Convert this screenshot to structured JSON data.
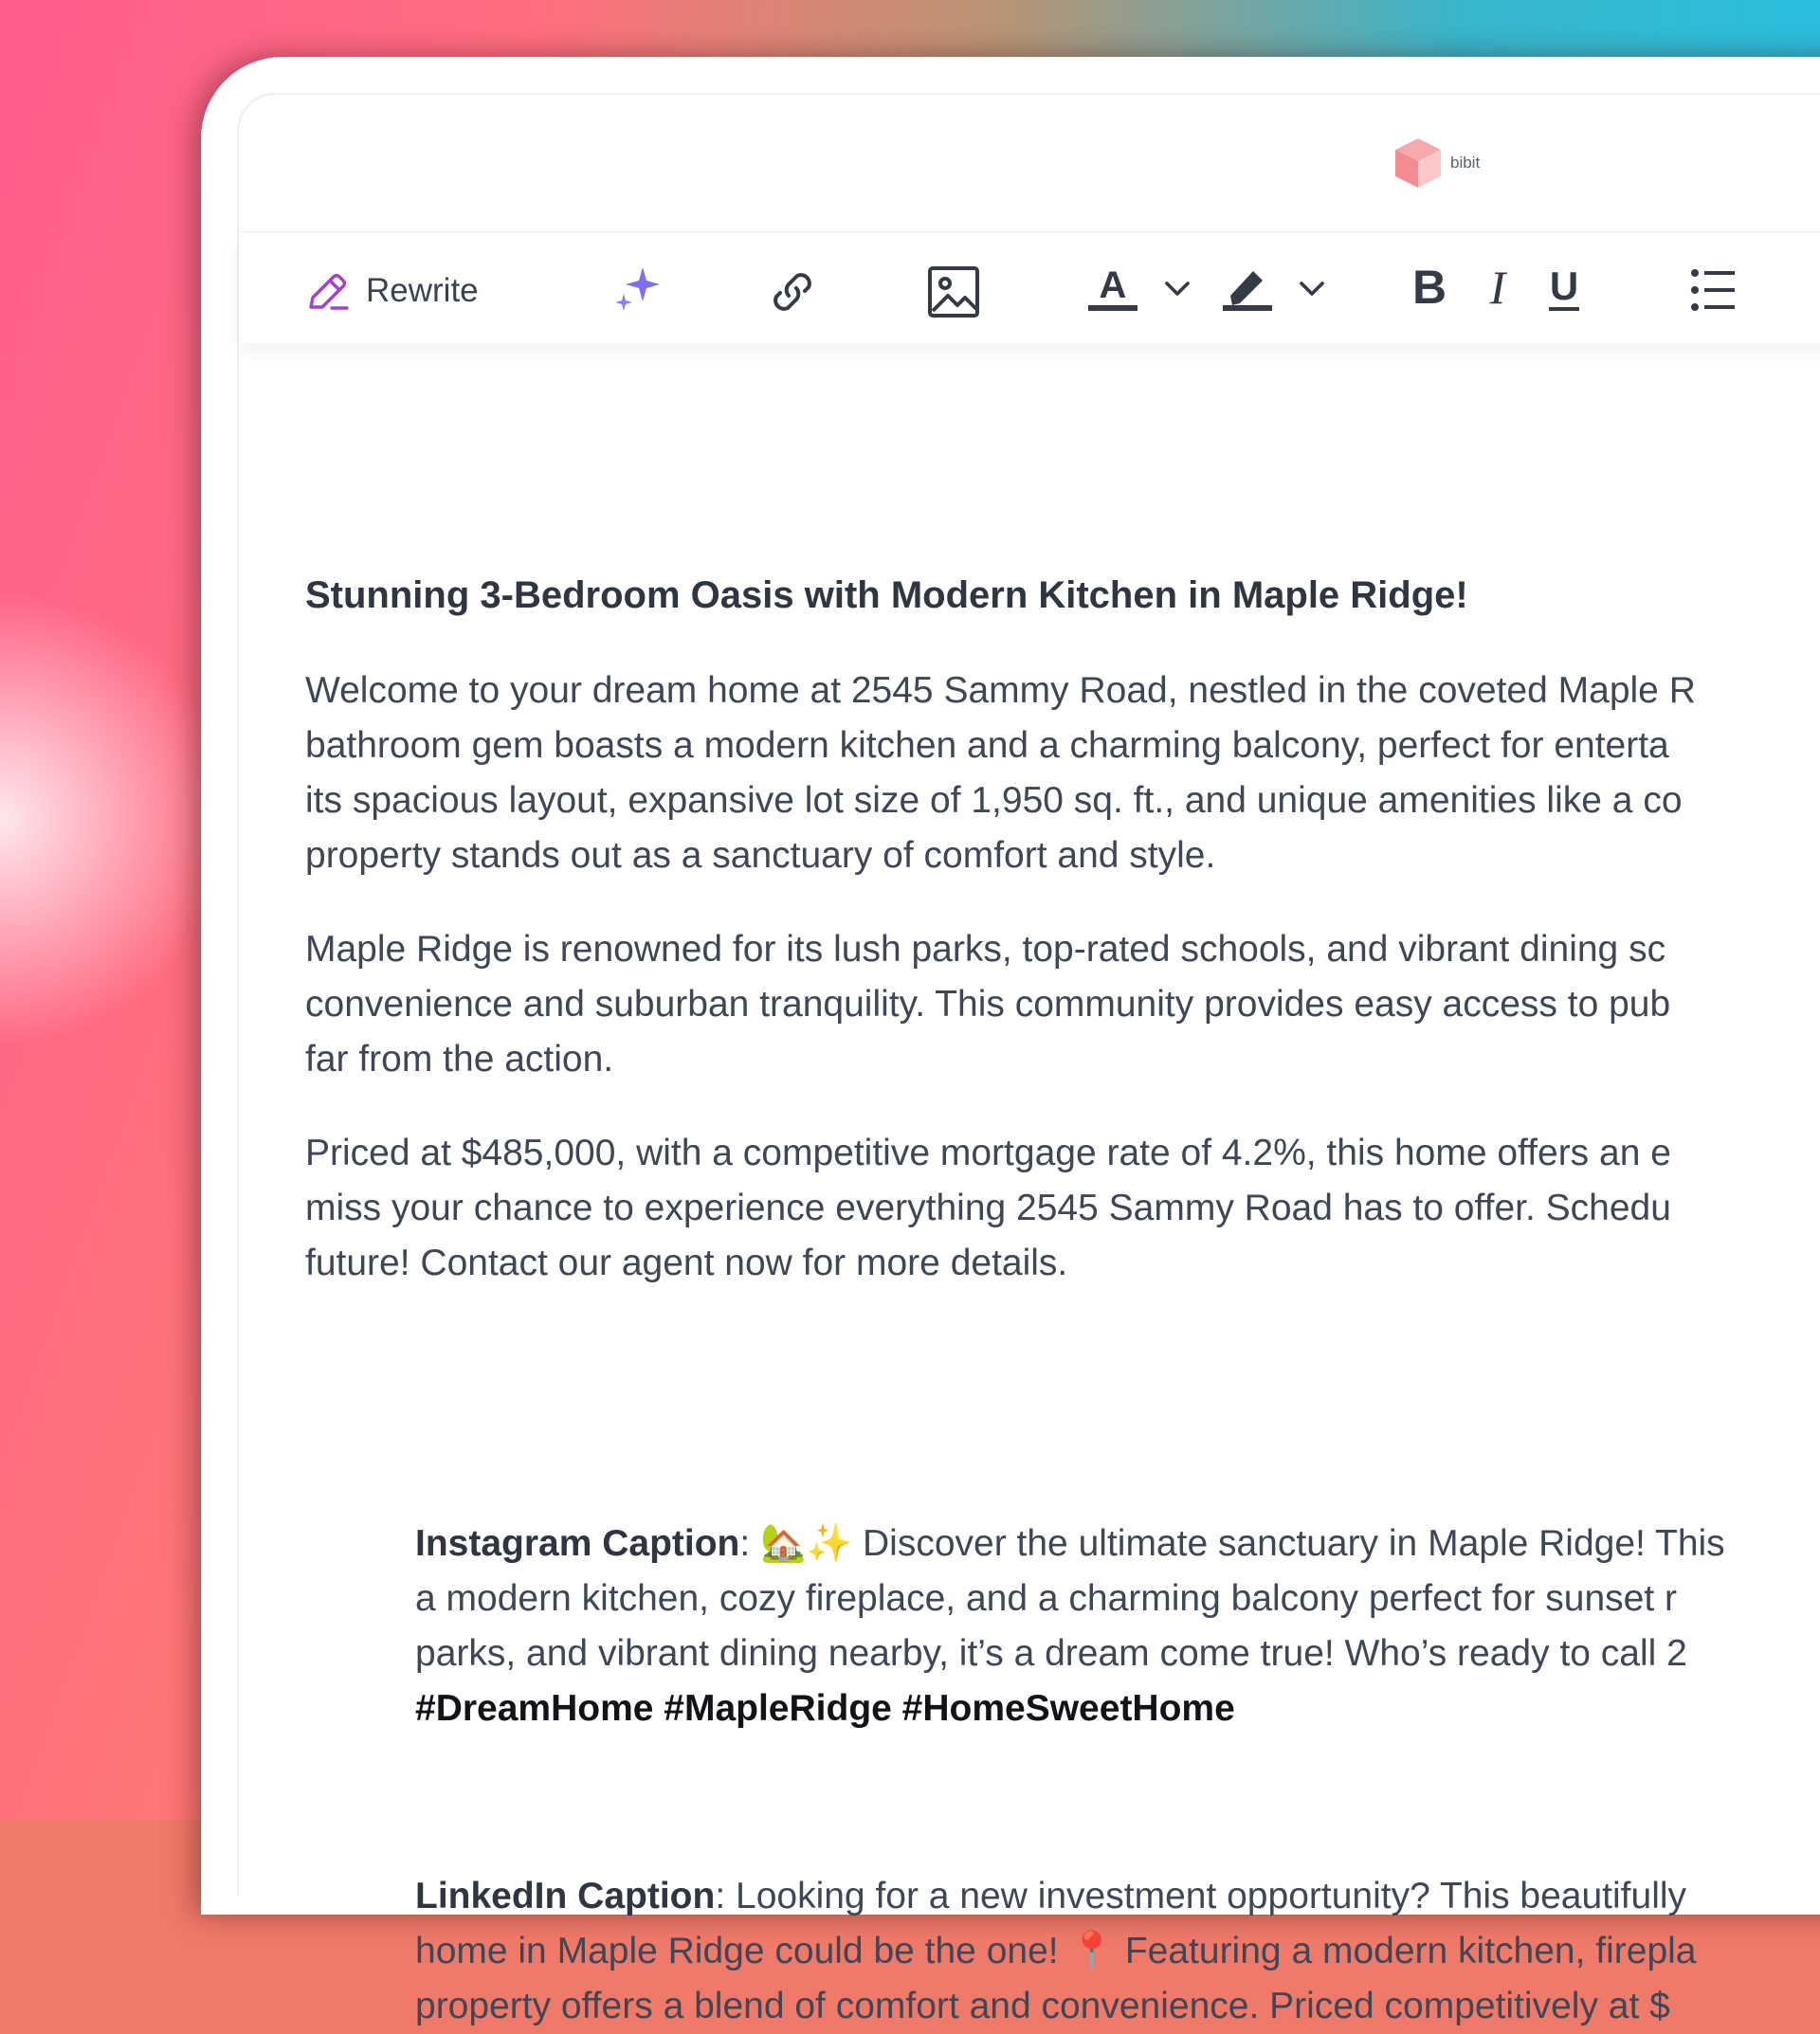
{
  "app": {
    "logo_text": "bibit",
    "accent": "#9b3fd6"
  },
  "toolbar": {
    "rewrite_label": "Rewrite",
    "icons": [
      "pencil-icon",
      "sparkle-icon",
      "link-icon",
      "image-icon",
      "text-color-icon",
      "chevron-down-icon",
      "highlighter-icon",
      "chevron-down-icon",
      "bold-icon",
      "italic-icon",
      "underline-icon",
      "bullet-list-icon"
    ],
    "bold_glyph": "B",
    "italic_glyph": "I",
    "underline_glyph": "U",
    "text_color_glyph": "A"
  },
  "document": {
    "headline": "Stunning 3-Bedroom Oasis with Modern Kitchen in Maple Ridge!",
    "paragraph1": [
      "Welcome to your dream home at 2545 Sammy Road, nestled in the coveted Maple R",
      "bathroom gem boasts a modern kitchen and a charming balcony, perfect for enterta",
      "its spacious layout, expansive lot size of 1,950 sq. ft., and unique amenities like a co",
      "property stands out as a sanctuary of comfort and style."
    ],
    "paragraph2": [
      "Maple Ridge is renowned for its lush parks, top-rated schools, and vibrant dining sc",
      "convenience and suburban tranquility. This community provides easy access to pub",
      "far from the action."
    ],
    "paragraph3": [
      "Priced at $485,000, with a competitive mortgage rate of 4.2%, this home offers an e",
      "miss your chance to experience everything 2545 Sammy Road has to offer. Schedu",
      "future! Contact our agent now for more details."
    ],
    "instagram": {
      "label": "Instagram Caption",
      "first_line": ": 🏡✨ Discover the ultimate sanctuary in Maple Ridge! This",
      "lines": [
        "a modern kitchen, cozy fireplace, and a charming balcony perfect for sunset r",
        "parks, and vibrant dining nearby, it’s a dream come true! Who’s ready to call 2"
      ],
      "hashtags": "#DreamHome #MapleRidge #HomeSweetHome"
    },
    "linkedin": {
      "label": "LinkedIn Caption",
      "first_line": ": Looking for a new investment opportunity? This beautifully",
      "lines": [
        "home in Maple Ridge could be the one! 📍 Featuring a modern kitchen, firepla",
        "property offers a blend of comfort and convenience. Priced competitively at $"
      ]
    }
  }
}
